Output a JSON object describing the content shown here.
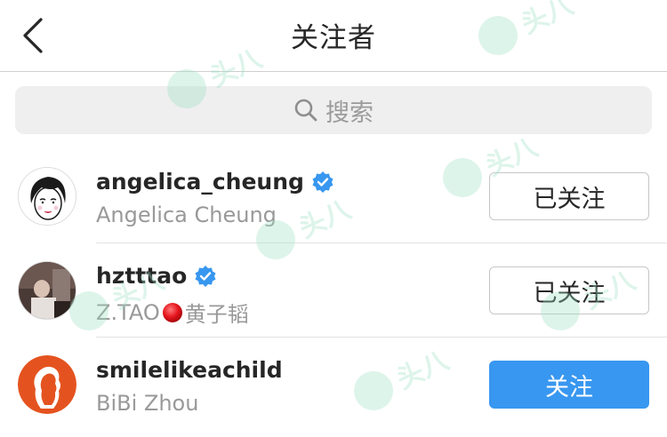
{
  "header": {
    "title": "关注者",
    "back_icon": "chevron-left-icon"
  },
  "search": {
    "placeholder": "搜索",
    "icon": "search-icon"
  },
  "list": [
    {
      "username": "angelica_cheung",
      "fullname": "Angelica Cheung",
      "verified": true,
      "button_label": "已关注",
      "button_state": "following"
    },
    {
      "username": "hztttao",
      "fullname_prefix": "Z.TAO",
      "fullname_suffix": "黄子韬",
      "verified": true,
      "button_label": "已关注",
      "button_state": "following"
    },
    {
      "username": "smilelikeachild",
      "fullname": "BiBi Zhou",
      "verified": false,
      "button_label": "关注",
      "button_state": "follow"
    }
  ],
  "colors": {
    "accent": "#3897f0",
    "text": "#262626",
    "secondary_text": "#999999",
    "divider": "#e3e3e3",
    "search_bg": "#efeff0",
    "verified": "#3897f0"
  },
  "watermark": {
    "text": "头八"
  }
}
